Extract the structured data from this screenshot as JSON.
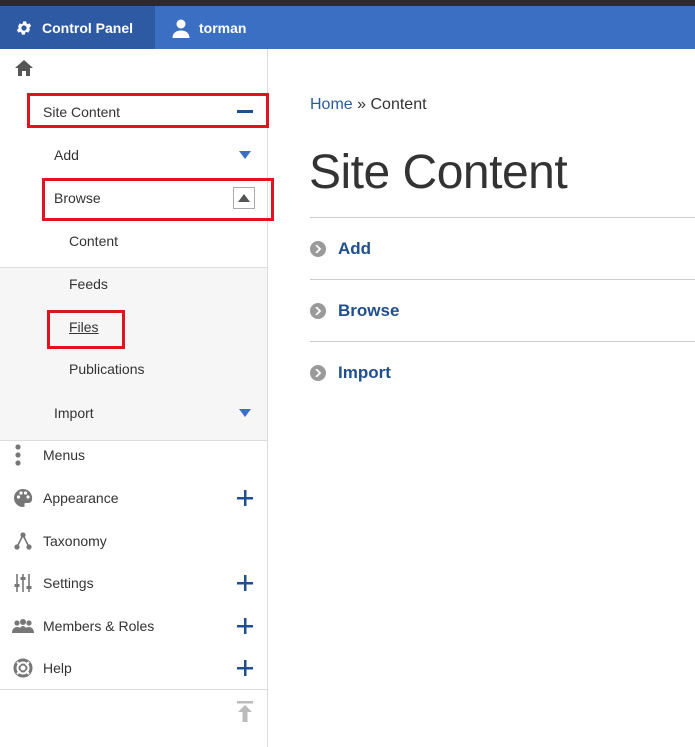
{
  "toolbar": {
    "control_panel_label": "Control Panel",
    "user_label": "torman"
  },
  "tray": {
    "items": [
      {
        "label": "Site Content"
      },
      {
        "label": "Add"
      },
      {
        "label": "Browse"
      },
      {
        "label": "Content"
      },
      {
        "label": "Feeds"
      },
      {
        "label": "Files"
      },
      {
        "label": "Publications"
      },
      {
        "label": "Import"
      },
      {
        "label": "Menus"
      },
      {
        "label": "Appearance"
      },
      {
        "label": "Taxonomy"
      },
      {
        "label": "Settings"
      },
      {
        "label": "Members & Roles"
      },
      {
        "label": "Help"
      }
    ]
  },
  "main": {
    "breadcrumb": {
      "home": "Home",
      "separator": "»",
      "current": "Content"
    },
    "title": "Site Content",
    "admin_items": [
      {
        "label": "Add"
      },
      {
        "label": "Browse"
      },
      {
        "label": "Import"
      }
    ]
  },
  "colors": {
    "toolbar_bg": "#3a6fc4",
    "toolbar_active_bg": "#2e5aa3",
    "link_blue": "#1f4f8f",
    "annotation_red": "#e0141e"
  },
  "icons": {
    "control_panel": "gear-icon",
    "user": "user-icon",
    "home": "home-icon",
    "menus": "menu-dots-icon",
    "appearance": "palette-icon",
    "taxonomy": "hierarchy-icon",
    "settings": "sliders-icon",
    "members": "people-icon",
    "help": "lifebuoy-icon",
    "collapse_tray": "pin-top-icon"
  }
}
